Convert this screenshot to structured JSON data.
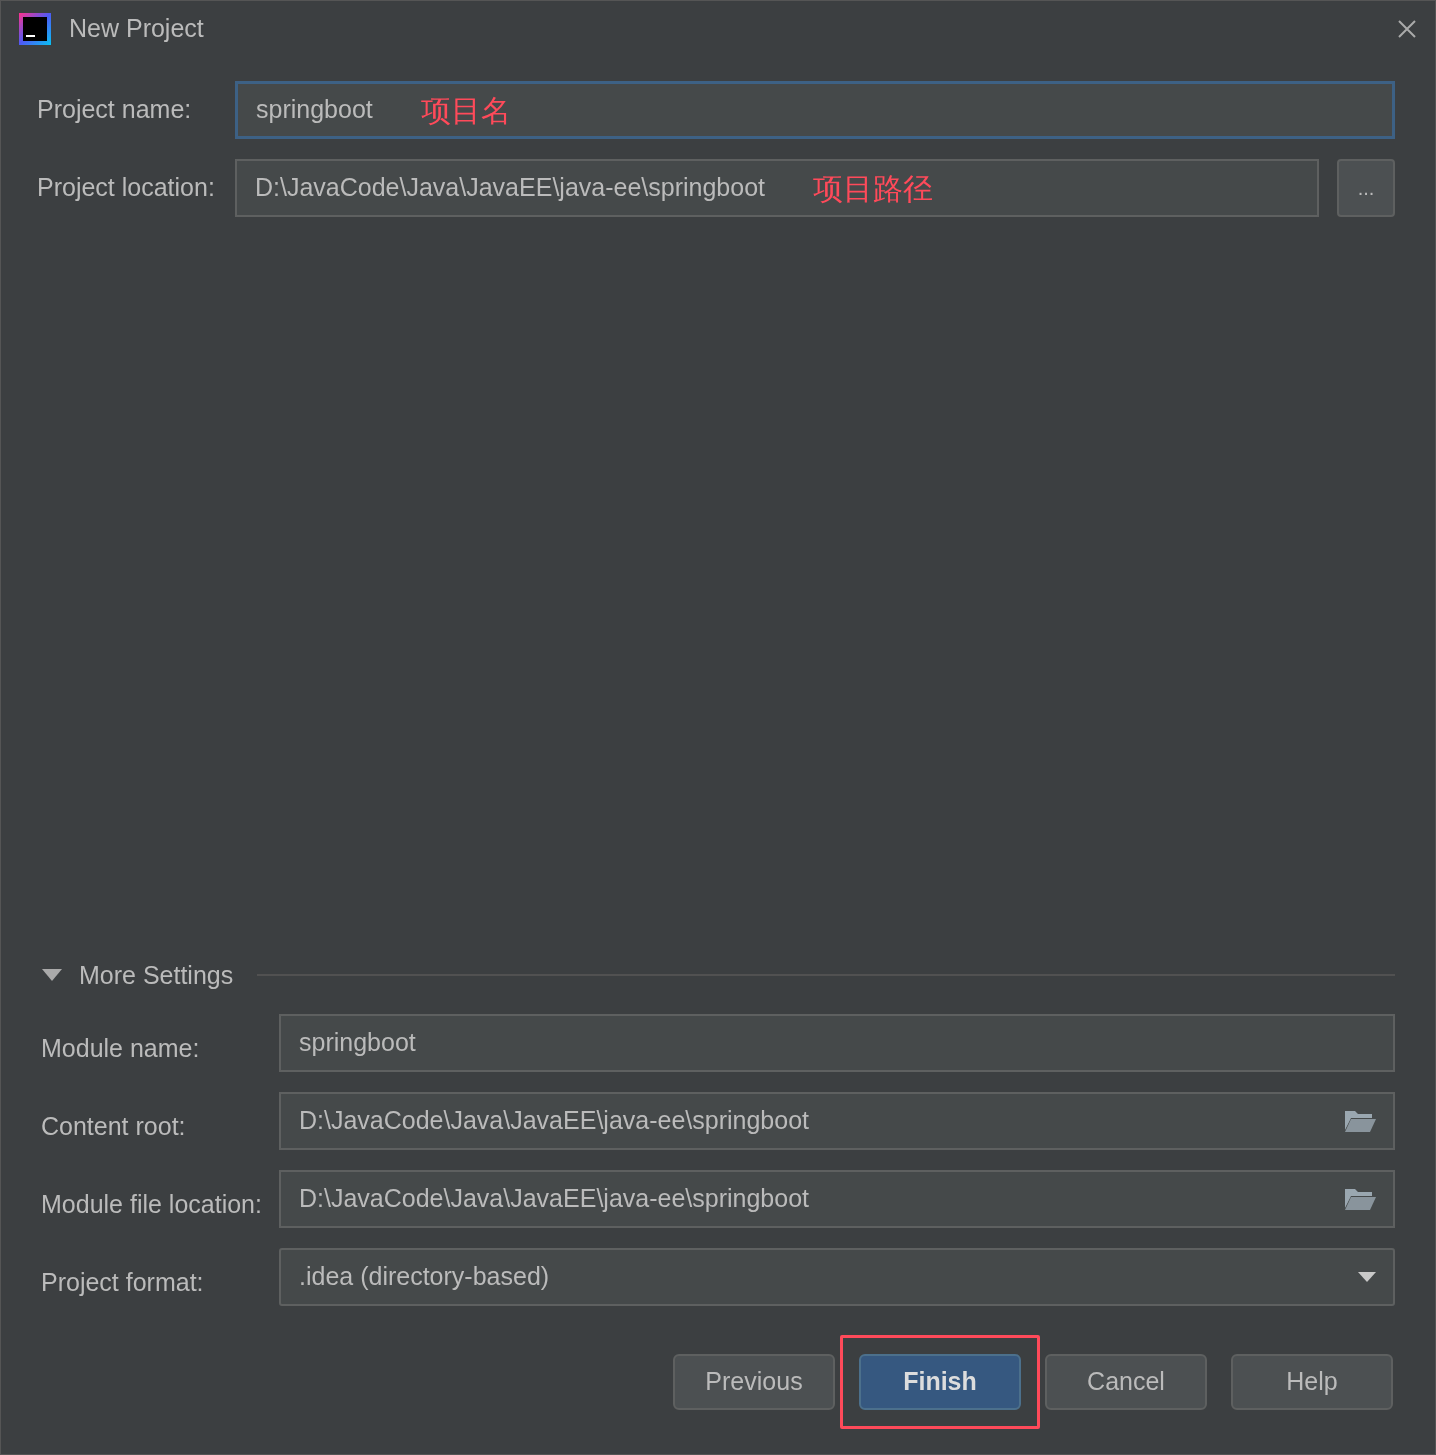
{
  "window": {
    "title": "New Project"
  },
  "fields": [
    {
      "label": "Project name:",
      "value": "springboot",
      "focused": true,
      "annotation": "项目名"
    },
    {
      "label": "Project location:",
      "value": "D:\\JavaCode\\Java\\JavaEE\\java-ee\\springboot",
      "focused": false,
      "annotation": "项目路径",
      "browse": "..."
    }
  ],
  "more_settings": {
    "title": "More Settings",
    "expanded": true,
    "fields": [
      {
        "kind": "text",
        "label": "Module name:",
        "value": "springboot"
      },
      {
        "kind": "folder",
        "label": "Content root:",
        "value": "D:\\JavaCode\\Java\\JavaEE\\java-ee\\springboot"
      },
      {
        "kind": "folder",
        "label": "Module file location:",
        "value": "D:\\JavaCode\\Java\\JavaEE\\java-ee\\springboot"
      },
      {
        "kind": "select",
        "label": "Project format:",
        "value": ".idea (directory-based)"
      }
    ]
  },
  "buttons": [
    {
      "label": "Previous",
      "default": false,
      "highlighted": false
    },
    {
      "label": "Finish",
      "default": true,
      "highlighted": true
    },
    {
      "label": "Cancel",
      "default": false,
      "highlighted": false
    },
    {
      "label": "Help",
      "default": false,
      "highlighted": false
    }
  ]
}
